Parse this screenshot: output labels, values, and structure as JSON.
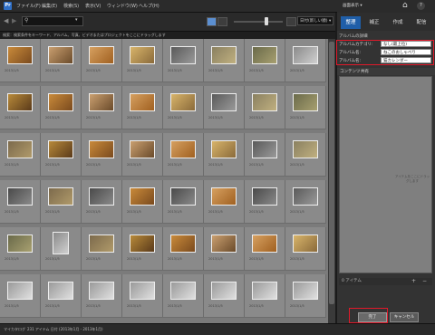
{
  "menu": {
    "logo": "Pr",
    "items": [
      "ファイル(F)",
      "編集(E)",
      "検索(S)",
      "表示(V)",
      "ウィンドウ(W)",
      "ヘルプ(H)"
    ],
    "display_button": "画面表示 ▾"
  },
  "toolbar": {
    "search_placeholder": "",
    "sort_option": "日付(新しい順) ▾"
  },
  "tabs": [
    "整理",
    "補正",
    "作成",
    "配信"
  ],
  "browse_header": "検索：検索条件をキーワード、アルバム、写真、ビデオまたはプロジェクトをここにドラッグします",
  "grid": {
    "date_label": "2013/1/5",
    "rows": 6,
    "cols": 8
  },
  "panel": {
    "title": "アルバムの詳細",
    "fields": [
      {
        "label": "アルバムカテゴリ:",
        "value": "なし(最上位)"
      },
      {
        "label": "アルバム名:",
        "value": "ねこのおしゃべり"
      },
      {
        "label": "アルバム名:",
        "value": "猫カレンダー"
      }
    ],
    "subtabs": [
      "コンテンツ",
      "共有"
    ],
    "empty_message": "アイテムをここにドラッグします",
    "items_label": "0 アイテム",
    "done_label": "完了",
    "cancel_label": "キャンセル"
  },
  "status": {
    "left": "マイカタログ",
    "text": "231 アイテム 日付 (2013年1月 - 2013年1月)"
  }
}
